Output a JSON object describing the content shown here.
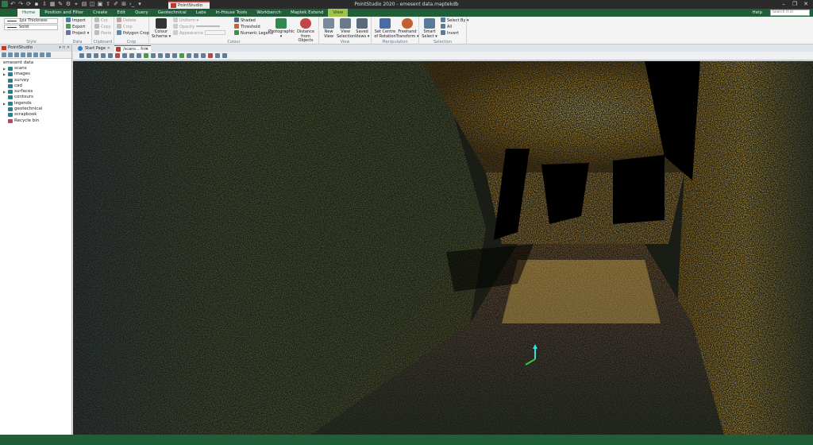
{
  "window": {
    "title": "PointStudio 2020 - emesent data.maptekdb",
    "context_tab": "PointStudio",
    "controls": [
      "–",
      "❐",
      "✕"
    ]
  },
  "ribbon_tabs": [
    "Home",
    "Position and Filter",
    "Create",
    "Edit",
    "Query",
    "Geotechnical",
    "Labs",
    "In-House Tools",
    "Workbench",
    "Maptek Extend",
    "View"
  ],
  "help_label": "Help",
  "search_placeholder": "Search (F3)",
  "ribbon": {
    "style": {
      "thickness": "1px Thickness",
      "line": "Solid",
      "label": "Style"
    },
    "data": {
      "items": [
        "Import",
        "Export",
        "Project"
      ],
      "label": "Data"
    },
    "clipboard": {
      "items": [
        "Cut",
        "Copy",
        "Paste"
      ],
      "label": "Clipboard"
    },
    "crop": {
      "items": [
        "Delete",
        "Crop",
        "Polygon Crop"
      ],
      "label": "Crop"
    },
    "colour": {
      "colour_scheme": "Colour Scheme",
      "uniform": "Uniform",
      "opacity": "Opacity",
      "appearance": "Appearance",
      "shaded": "Shaded",
      "threshold": "Threshold",
      "numeric_legend": "Numeric Legend",
      "photographic": "Photographic",
      "distance": "Distance from Objects",
      "label": "Colour"
    },
    "view": {
      "items": [
        "New View",
        "View Selection",
        "Saved Views"
      ],
      "label": "View"
    },
    "manipulation": {
      "items": [
        "Set Centre of Rotation",
        "Freehand Transform"
      ],
      "label": "Manipulation"
    },
    "selection": {
      "smart": "Smart Select",
      "items": [
        "Select By",
        "All",
        "Invert"
      ],
      "label": "Selection"
    }
  },
  "left_panel": {
    "title": "PointStudio",
    "root": "emesent data",
    "items": [
      "scans",
      "images",
      "survey",
      "cad",
      "surfaces",
      "contours",
      "legends",
      "geotechnical",
      "scrapbook",
      "Recycle bin"
    ]
  },
  "doc_tabs": [
    {
      "label": "Start Page"
    },
    {
      "label": "/scans... fcm",
      "active": true
    }
  ],
  "colors": {
    "accent_green": "#1f5e37",
    "view_tab": "#9fc24a",
    "brand_red": "#c0392b"
  }
}
